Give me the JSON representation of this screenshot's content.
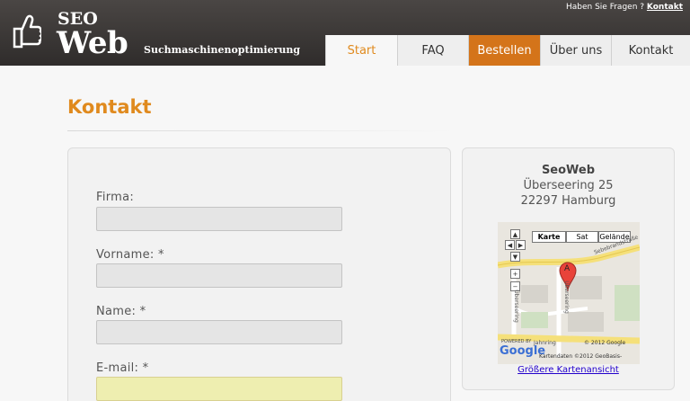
{
  "header": {
    "logo_seo": "SEO",
    "logo_web": "Web",
    "tagline": "Suchmaschinenoptimierung",
    "top_question": "Haben Sie Fragen ?",
    "top_contact": "Kontakt"
  },
  "nav": {
    "tabs": [
      {
        "label": "Start",
        "state": "active"
      },
      {
        "label": "FAQ",
        "state": "normal"
      },
      {
        "label": "Bestellen",
        "state": "highlight"
      },
      {
        "label": "Über uns",
        "state": "normal"
      },
      {
        "label": "Kontakt",
        "state": "normal"
      }
    ]
  },
  "main": {
    "title": "Kontakt",
    "form": {
      "fields": [
        {
          "label": "Firma:",
          "value": ""
        },
        {
          "label": "Vorname: *",
          "value": ""
        },
        {
          "label": "Name: *",
          "value": ""
        },
        {
          "label": "E-mail: *",
          "value": ""
        }
      ]
    }
  },
  "sidebar": {
    "company": "SeoWeb",
    "street": "Überseering 25",
    "city": "22297 Hamburg",
    "map": {
      "type_karte": "Karte",
      "type_sat": "Sat",
      "type_gelaende": "Gelände",
      "pin_label": "A",
      "street1": "Überseering",
      "street2": "Sebebrandstraße",
      "street3": "Überseering",
      "street4": "Jahnring",
      "powered": "POWERED BY",
      "google": "Google",
      "copyright": "© 2012 Google",
      "data": "Kartendaten ©2012 GeoBasis-"
    },
    "map_link": "Größere Kartenansicht"
  },
  "colors": {
    "accent": "#e08a1e",
    "order_tab": "#d4741a",
    "header_bg": "#3a3634"
  }
}
